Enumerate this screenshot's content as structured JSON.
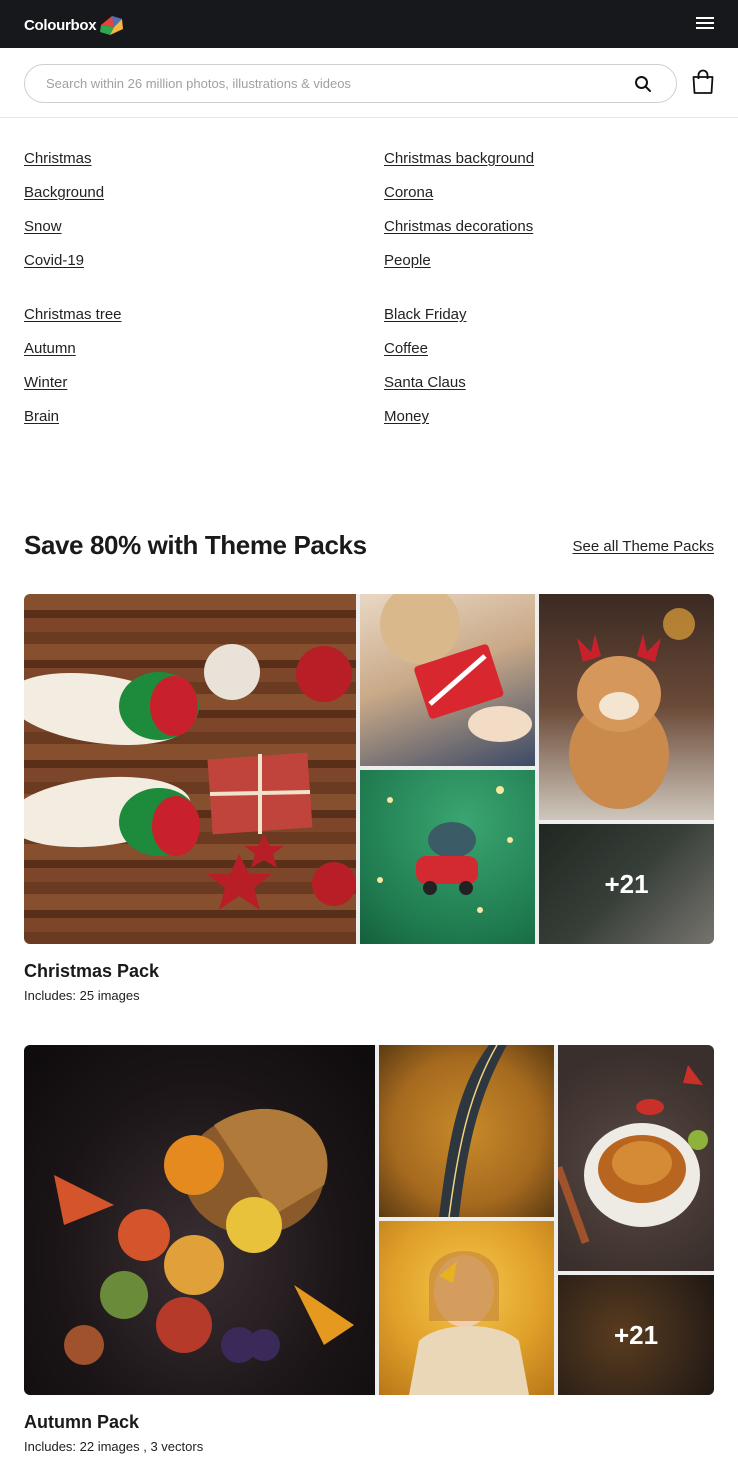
{
  "header": {
    "logo_text": "Colourbox"
  },
  "search": {
    "placeholder": "Search within 26 million photos, illustrations & videos"
  },
  "links": {
    "left_group1": [
      "Christmas",
      "Background",
      "Snow",
      "Covid-19"
    ],
    "right_group1": [
      "Christmas background",
      "Corona",
      "Christmas decorations",
      "People"
    ],
    "left_group2": [
      "Christmas tree",
      "Autumn",
      "Winter",
      "Brain"
    ],
    "right_group2": [
      "Black Friday",
      "Coffee",
      "Santa Claus",
      "Money"
    ]
  },
  "theme_packs": {
    "title": "Save 80% with Theme Packs",
    "see_all": "See all Theme Packs",
    "packs": [
      {
        "title": "Christmas Pack",
        "includes": "Includes: 25 images",
        "more": "+21"
      },
      {
        "title": "Autumn Pack",
        "includes": "Includes: 22 images , 3 vectors",
        "more": "+21"
      }
    ]
  },
  "colors": {
    "topbar": "#17181c",
    "text": "#1a1a1a"
  }
}
